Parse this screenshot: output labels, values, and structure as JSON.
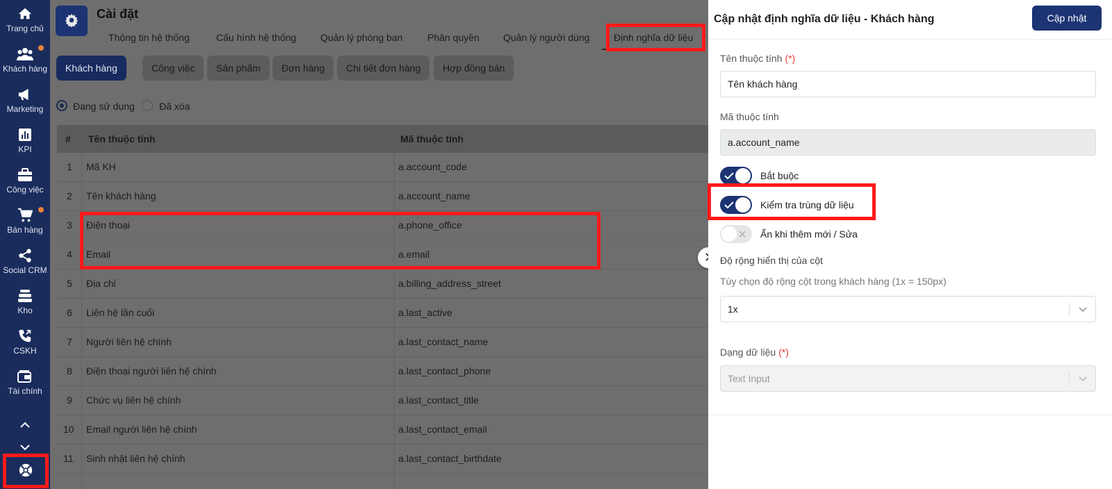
{
  "sidebar": {
    "items": [
      {
        "label": "Trang chủ",
        "icon": "home-icon"
      },
      {
        "label": "Khách hàng",
        "icon": "users-icon",
        "dot": true
      },
      {
        "label": "Marketing",
        "icon": "megaphone-icon"
      },
      {
        "label": "KPI",
        "icon": "bar-chart-icon"
      },
      {
        "label": "Công việc",
        "icon": "briefcase-icon"
      },
      {
        "label": "Bán hàng",
        "icon": "cart-icon",
        "dot": true
      },
      {
        "label": "Social CRM",
        "icon": "share-icon"
      },
      {
        "label": "Kho",
        "icon": "warehouse-icon"
      },
      {
        "label": "CSKH",
        "icon": "phone-icon"
      },
      {
        "label": "Tài chính",
        "icon": "wallet-icon"
      }
    ]
  },
  "header": {
    "title": "Cài đặt",
    "tabs": [
      "Thông tin hệ thống",
      "Cấu hình hệ thống",
      "Quản lý phòng ban",
      "Phân quyền",
      "Quản lý người dùng",
      "Định nghĩa dữ liệu"
    ],
    "active_tab": "Định nghĩa dữ liệu"
  },
  "subtabs": [
    "Khách hàng",
    "Công việc",
    "Sản phẩm",
    "Đơn hàng",
    "Chi tiết đơn hàng",
    "Hợp đồng bán"
  ],
  "filter": {
    "in_use": "Đang sử dụng",
    "deleted": "Đã xóa",
    "selected": "Đang sử dụng"
  },
  "table": {
    "headers": [
      "#",
      "Tên thuộc tính",
      "Mã thuộc tính"
    ],
    "rows": [
      [
        "1",
        "Mã KH",
        "a.account_code"
      ],
      [
        "2",
        "Tên khách hàng",
        "a.account_name"
      ],
      [
        "3",
        "Điện thoại",
        "a.phone_office"
      ],
      [
        "4",
        "Email",
        "a.email"
      ],
      [
        "5",
        "Địa chỉ",
        "a.billing_address_street"
      ],
      [
        "6",
        "Liên hệ lần cuối",
        "a.last_active"
      ],
      [
        "7",
        "Người liên hệ chính",
        "a.last_contact_name"
      ],
      [
        "8",
        "Điện thoại người liên hệ chính",
        "a.last_contact_phone"
      ],
      [
        "9",
        "Chức vụ liên hệ chính",
        "a.last_contact_title"
      ],
      [
        "10",
        "Email người liên hệ chính",
        "a.last_contact_email"
      ],
      [
        "11",
        "Sinh nhật liên hệ chính",
        "a.last_contact_birthdate"
      ]
    ]
  },
  "panel": {
    "title": "Cập nhật định nghĩa dữ liệu - Khách hàng",
    "update_label": "Cập nhật",
    "name_label": "Tên thuộc tính",
    "required_mark": "(*)",
    "name_value": "Tên khách hàng",
    "code_label": "Mã thuộc tính",
    "code_value": "a.account_name",
    "toggles": [
      {
        "label": "Bắt buộc",
        "on": true
      },
      {
        "label": "Kiểm tra trùng dữ liệu",
        "on": true
      },
      {
        "label": "Ẩn khi thêm mới / Sửa",
        "on": false
      }
    ],
    "width_label": "Độ rộng hiển thị của cột",
    "width_hint": "Tùy chọn độ rộng cột trong khách hàng (1x = 150px)",
    "width_value": "1x",
    "type_label": "Dạng dữ liệu",
    "type_value": "Text Input"
  },
  "colors": {
    "primary": "#1c3474",
    "sidebar": "#1a2c5c",
    "highlight": "#ff1a1a",
    "badge": "#e8833a"
  }
}
